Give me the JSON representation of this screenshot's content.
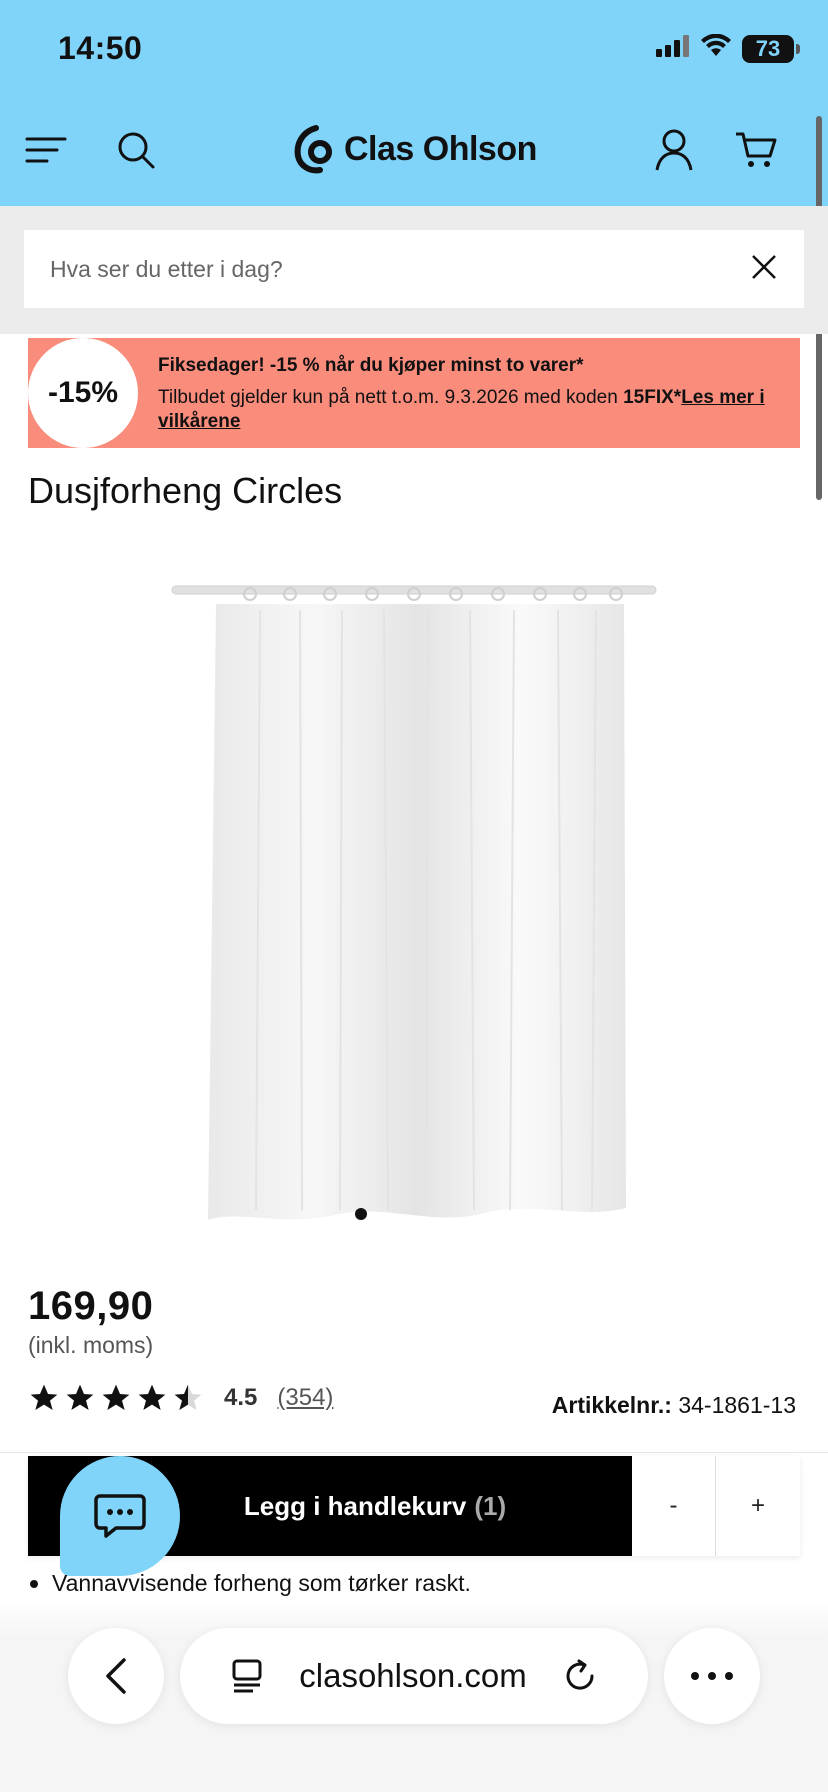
{
  "status_bar": {
    "time": "14:50",
    "battery": "73",
    "icons": [
      "cellular-signal-icon",
      "wifi-icon",
      "battery-icon"
    ]
  },
  "header": {
    "brand": "Clas Ohlson",
    "icons": [
      "menu-icon",
      "search-icon",
      "account-icon",
      "cart-icon"
    ]
  },
  "search": {
    "placeholder": "Hva ser du etter i dag?"
  },
  "promo": {
    "badge": "-15%",
    "title": "Fiksedager! -15 % når du kjøper minst to varer*",
    "body": "Tilbudet gjelder kun på nett t.o.m. 9.3.2026 med koden",
    "code": "15FIX*",
    "link": "Les mer i vilkårene",
    "color": "#fa8c7c"
  },
  "product": {
    "title": "Dusjforheng Circles",
    "price": "169,90",
    "vat_note": "(inkl. moms)",
    "rating_value": "4.5",
    "rating_stars": 4.5,
    "rating_count": "(354)",
    "article_label": "Artikkelnr.:",
    "article_number": "34-1861-13",
    "bullet": "Vannavvisende forheng som tørker raskt."
  },
  "cart_bar": {
    "add_label": "Legg i handlekurv",
    "qty_label": "(1)",
    "minus": "-",
    "plus": "+"
  },
  "browser": {
    "url": "clasohlson.com"
  },
  "colors": {
    "header_bg": "#80d4fa",
    "accent": "#80d4fa"
  }
}
